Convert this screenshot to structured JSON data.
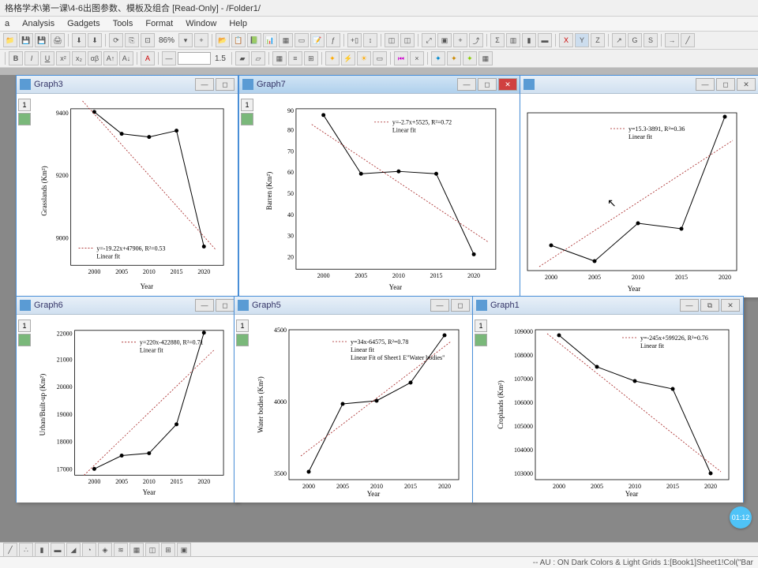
{
  "app_title": "格格学术\\第一课\\4-6出图参数、模板及组合 [Read-Only] - /Folder1/",
  "menu": [
    "a",
    "Analysis",
    "Gadgets",
    "Tools",
    "Format",
    "Window",
    "Help"
  ],
  "zoom": "86%",
  "timer": "01:12",
  "status": "-- AU : ON Dark Colors & Light Grids 1:[Book1]Sheet1!Col(\"Bar",
  "line_width": "1.5",
  "graphs": {
    "g3": {
      "title": "Graph3",
      "eq": "y=-19.22x+47906, R²=0.53",
      "fit": "Linear fit",
      "xlabel": "Year",
      "ylabel": "Grasslands (Km²)"
    },
    "g7": {
      "title": "Graph7",
      "eq": "y=-2.7x+5525, R²=0.72",
      "fit": "Linear fit",
      "xlabel": "Year",
      "ylabel": "Barren (Km²)"
    },
    "gR": {
      "eq": "y=15.3-3891, R²=0.36",
      "fit": "Linear fit",
      "xlabel": "Year"
    },
    "g6": {
      "title": "Graph6",
      "eq": "y=220x-422880, R²=0.71",
      "fit": "Linear fit",
      "xlabel": "Year",
      "ylabel": "Urban/Built-up (Km²)"
    },
    "g5": {
      "title": "Graph5",
      "eq": "y=34x-64575, R²=0.78",
      "fit": "Linear fit",
      "fit2": "Linear Fit of Sheet1 E\"Water bodies\"",
      "xlabel": "Year",
      "ylabel": "Water bodies (Km²)"
    },
    "g1": {
      "title": "Graph1",
      "eq": "y=-245x+599226, R²=0.76",
      "fit": "Linear fit",
      "xlabel": "Year",
      "ylabel": "Croplands (Km²)"
    }
  },
  "chart_data": [
    {
      "id": "g3",
      "type": "line",
      "x": [
        2000,
        2005,
        2010,
        2015,
        2020
      ],
      "y": [
        9410,
        9340,
        9330,
        9350,
        8980
      ],
      "ylim": [
        8950,
        9450
      ],
      "yticks": [
        9000,
        9200,
        9400
      ],
      "fit": {
        "slope": -19.22,
        "intercept": 47906,
        "r2": 0.53
      }
    },
    {
      "id": "g7",
      "type": "line",
      "x": [
        2000,
        2005,
        2010,
        2015,
        2020
      ],
      "y": [
        88,
        60,
        61,
        60,
        22
      ],
      "ylim": [
        15,
        92
      ],
      "yticks": [
        20,
        30,
        40,
        50,
        60,
        70,
        80,
        90
      ],
      "fit": {
        "slope": -2.7,
        "intercept": 5525,
        "r2": 0.72
      }
    },
    {
      "id": "gR",
      "type": "line",
      "x": [
        2000,
        2005,
        2010,
        2015,
        2020
      ],
      "y": [
        100,
        72,
        140,
        130,
        330
      ],
      "ylim": [
        60,
        340
      ],
      "fit": {
        "slope": 15.3,
        "intercept": -3891,
        "r2": 0.36
      }
    },
    {
      "id": "g6",
      "type": "line",
      "x": [
        2000,
        2005,
        2010,
        2015,
        2020
      ],
      "y": [
        17000,
        17500,
        17600,
        18700,
        22100
      ],
      "ylim": [
        16800,
        22200
      ],
      "yticks": [
        17000,
        18000,
        19000,
        20000,
        21000,
        22000
      ],
      "fit": {
        "slope": 220,
        "intercept": -422880,
        "r2": 0.71
      }
    },
    {
      "id": "g5",
      "type": "line",
      "x": [
        2000,
        2005,
        2010,
        2015,
        2020
      ],
      "y": [
        3530,
        4000,
        4020,
        4150,
        4480
      ],
      "ylim": [
        3480,
        4520
      ],
      "yticks": [
        3500,
        4000,
        4500
      ],
      "fit": {
        "slope": 34,
        "intercept": -64575,
        "r2": 0.78
      }
    },
    {
      "id": "g1",
      "type": "line",
      "x": [
        2000,
        2005,
        2010,
        2015,
        2020
      ],
      "y": [
        108900,
        107600,
        107000,
        106700,
        103100
      ],
      "ylim": [
        102800,
        109200
      ],
      "yticks": [
        103000,
        104000,
        105000,
        106000,
        107000,
        108000,
        109000
      ],
      "fit": {
        "slope": -245,
        "intercept": 599226,
        "r2": 0.76
      }
    }
  ]
}
